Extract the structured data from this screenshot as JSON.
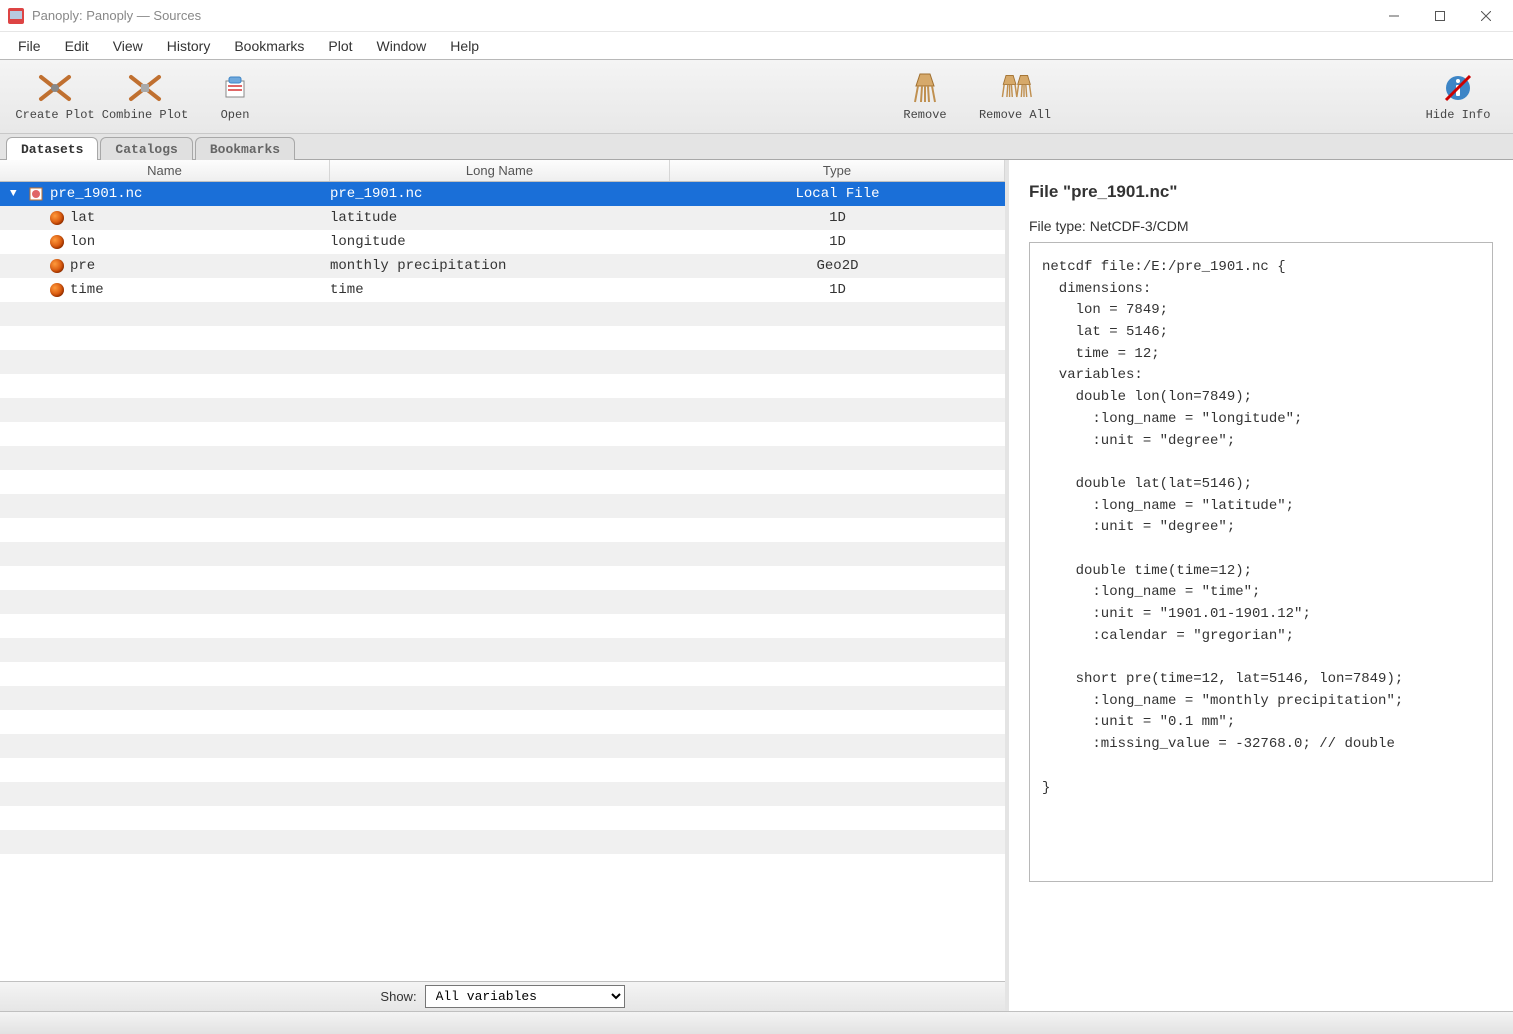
{
  "window": {
    "title": "Panoply: Panoply — Sources"
  },
  "menu": [
    "File",
    "Edit",
    "View",
    "History",
    "Bookmarks",
    "Plot",
    "Window",
    "Help"
  ],
  "toolbar": {
    "create_plot": "Create Plot",
    "combine_plot": "Combine Plot",
    "open": "Open",
    "remove": "Remove",
    "remove_all": "Remove All",
    "hide_info": "Hide Info"
  },
  "tabs": {
    "datasets": "Datasets",
    "catalogs": "Catalogs",
    "bookmarks": "Bookmarks",
    "active": "datasets"
  },
  "columns": {
    "name": "Name",
    "long": "Long Name",
    "type": "Type"
  },
  "rows": [
    {
      "kind": "file",
      "name": "pre_1901.nc",
      "long": "pre_1901.nc",
      "type": "Local File",
      "selected": true
    },
    {
      "kind": "var",
      "name": "lat",
      "long": "latitude",
      "type": "1D"
    },
    {
      "kind": "var",
      "name": "lon",
      "long": "longitude",
      "type": "1D"
    },
    {
      "kind": "var",
      "name": "pre",
      "long": "monthly precipitation",
      "type": "Geo2D"
    },
    {
      "kind": "var",
      "name": "time",
      "long": "time",
      "type": "1D"
    }
  ],
  "show": {
    "label": "Show:",
    "value": "All variables"
  },
  "info": {
    "heading": "File \"pre_1901.nc\"",
    "filetype_label": "File type: ",
    "filetype_value": "NetCDF-3/CDM",
    "cdl": "netcdf file:/E:/pre_1901.nc {\n  dimensions:\n    lon = 7849;\n    lat = 5146;\n    time = 12;\n  variables:\n    double lon(lon=7849);\n      :long_name = \"longitude\";\n      :unit = \"degree\";\n\n    double lat(lat=5146);\n      :long_name = \"latitude\";\n      :unit = \"degree\";\n\n    double time(time=12);\n      :long_name = \"time\";\n      :unit = \"1901.01-1901.12\";\n      :calendar = \"gregorian\";\n\n    short pre(time=12, lat=5146, lon=7849);\n      :long_name = \"monthly precipitation\";\n      :unit = \"0.1 mm\";\n      :missing_value = -32768.0; // double\n\n}"
  }
}
